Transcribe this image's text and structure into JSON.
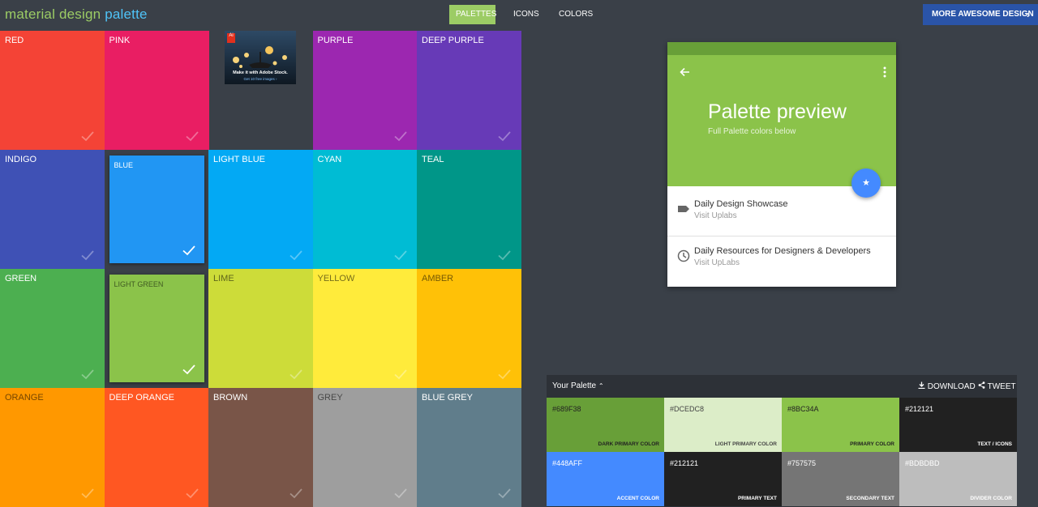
{
  "header": {
    "logo_part1": "material design",
    "logo_part2": "palette",
    "nav": [
      {
        "label": "PALETTES",
        "active": true
      },
      {
        "label": "ICONS",
        "active": false
      },
      {
        "label": "COLORS",
        "active": false
      }
    ],
    "more_button": "MORE AWESOME DESIGN"
  },
  "ad": {
    "headline": "Make it with Adobe Stock.",
    "cta": "Get 10 free images ›",
    "badge": "Ai"
  },
  "tiles": [
    {
      "name": "RED",
      "color": "#f44336",
      "text_dark": false,
      "selected": false
    },
    {
      "name": "PINK",
      "color": "#e91e63",
      "text_dark": false,
      "selected": false
    },
    {
      "name": "",
      "color": "",
      "text_dark": false,
      "selected": false,
      "empty": true
    },
    {
      "name": "PURPLE",
      "color": "#9c27b0",
      "text_dark": false,
      "selected": false
    },
    {
      "name": "DEEP PURPLE",
      "color": "#673ab7",
      "text_dark": false,
      "selected": false
    },
    {
      "name": "INDIGO",
      "color": "#3f51b5",
      "text_dark": false,
      "selected": false
    },
    {
      "name": "BLUE",
      "color": "#2196f3",
      "text_dark": false,
      "selected": true
    },
    {
      "name": "LIGHT BLUE",
      "color": "#03a9f4",
      "text_dark": false,
      "selected": false
    },
    {
      "name": "CYAN",
      "color": "#00bcd4",
      "text_dark": false,
      "selected": false
    },
    {
      "name": "TEAL",
      "color": "#009688",
      "text_dark": false,
      "selected": false
    },
    {
      "name": "GREEN",
      "color": "#4caf50",
      "text_dark": false,
      "selected": false
    },
    {
      "name": "LIGHT GREEN",
      "color": "#8bc34a",
      "text_dark": true,
      "selected": true
    },
    {
      "name": "LIME",
      "color": "#cddc39",
      "text_dark": true,
      "selected": false
    },
    {
      "name": "YELLOW",
      "color": "#ffeb3b",
      "text_dark": true,
      "selected": false
    },
    {
      "name": "AMBER",
      "color": "#ffc107",
      "text_dark": true,
      "selected": false
    },
    {
      "name": "ORANGE",
      "color": "#ff9800",
      "text_dark": true,
      "selected": false
    },
    {
      "name": "DEEP ORANGE",
      "color": "#ff5722",
      "text_dark": false,
      "selected": false
    },
    {
      "name": "BROWN",
      "color": "#795548",
      "text_dark": false,
      "selected": false
    },
    {
      "name": "GREY",
      "color": "#9e9e9e",
      "text_dark": true,
      "selected": false
    },
    {
      "name": "BLUE GREY",
      "color": "#607d8b",
      "text_dark": false,
      "selected": false
    }
  ],
  "preview": {
    "title": "Palette preview",
    "subtitle": "Full Palette colors below",
    "items": [
      {
        "title": "Daily Design Showcase",
        "subtitle": "Visit Uplabs",
        "icon": "label-icon"
      },
      {
        "title": "Daily Resources for Designers & Developers",
        "subtitle": "Visit UpLabs",
        "icon": "clock-icon"
      }
    ]
  },
  "palette_panel": {
    "title": "Your Palette",
    "download_label": "DOWNLOAD",
    "tweet_label": "TWEET",
    "swatches": [
      {
        "hex": "#689F38",
        "role": "DARK PRIMARY COLOR",
        "bg": "#689f38",
        "fg": "#222222"
      },
      {
        "hex": "#DCEDC8",
        "role": "LIGHT PRIMARY COLOR",
        "bg": "#dcedc8",
        "fg": "#444444"
      },
      {
        "hex": "#8BC34A",
        "role": "PRIMARY COLOR",
        "bg": "#8bc34a",
        "fg": "#222222"
      },
      {
        "hex": "#212121",
        "role": "TEXT / ICONS",
        "bg": "#212121",
        "fg": "#ffffff"
      },
      {
        "hex": "#448AFF",
        "role": "ACCENT COLOR",
        "bg": "#448aff",
        "fg": "#ffffff"
      },
      {
        "hex": "#212121",
        "role": "PRIMARY TEXT",
        "bg": "#212121",
        "fg": "#ffffff"
      },
      {
        "hex": "#757575",
        "role": "SECONDARY TEXT",
        "bg": "#757575",
        "fg": "#ffffff"
      },
      {
        "hex": "#BDBDBD",
        "role": "DIVIDER COLOR",
        "bg": "#bdbdbd",
        "fg": "#ffffff"
      }
    ]
  }
}
